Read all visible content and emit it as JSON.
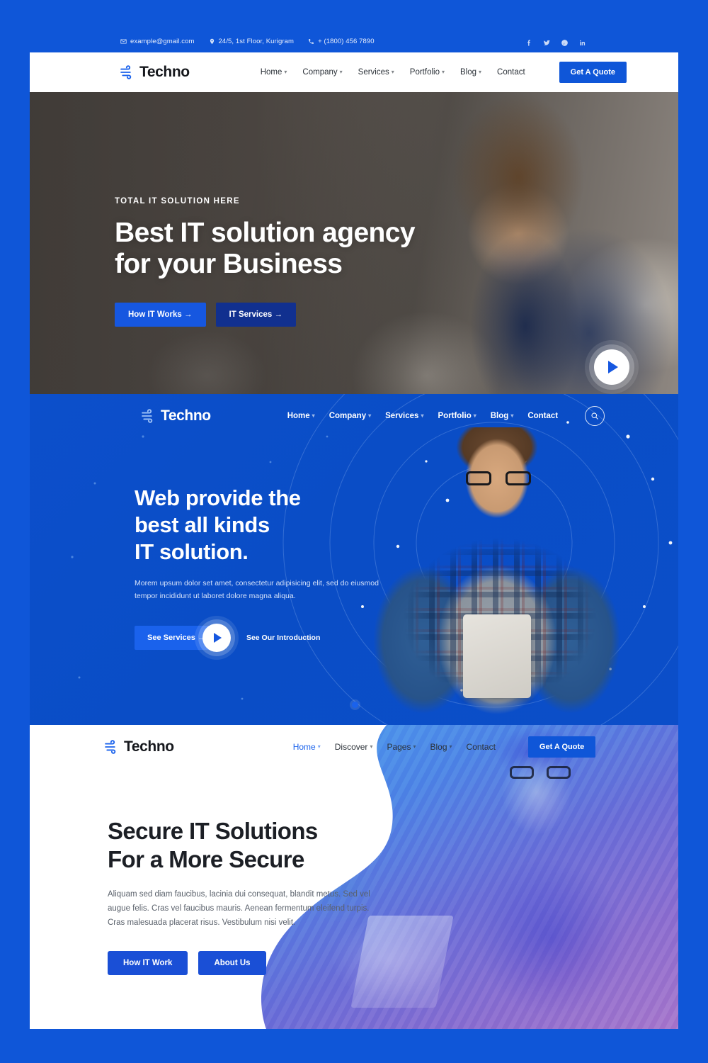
{
  "brand": {
    "name": "Techno",
    "logo_icon": "wind-swoosh-icon",
    "accent": "#0f56d8",
    "dark_accent": "#11308f"
  },
  "panel1": {
    "topbar": {
      "email": "example@gmail.com",
      "email_icon": "envelope-icon",
      "address": "24/5, 1st Floor, Kurigram",
      "address_icon": "map-pin-icon",
      "phone": "+ (1800) 456 7890",
      "phone_icon": "phone-icon",
      "social": [
        {
          "name": "facebook-icon",
          "label": "f"
        },
        {
          "name": "twitter-icon",
          "label": "t"
        },
        {
          "name": "pinterest-icon",
          "label": "p"
        },
        {
          "name": "linkedin-icon",
          "label": "in"
        }
      ]
    },
    "nav": [
      {
        "label": "Home",
        "caret": true
      },
      {
        "label": "Company",
        "caret": true
      },
      {
        "label": "Services",
        "caret": true
      },
      {
        "label": "Portfolio",
        "caret": true
      },
      {
        "label": "Blog",
        "caret": true
      },
      {
        "label": "Contact",
        "caret": false
      }
    ],
    "cta": "Get A Quote",
    "hero": {
      "eyebrow": "TOTAL IT SOLUTION HERE",
      "title_line1": "Best IT solution agency",
      "title_line2": "for your Business",
      "btn_primary": "How IT Works  →",
      "btn_secondary": "IT Services  →",
      "play_icon": "play-button-icon"
    }
  },
  "panel2": {
    "nav": [
      {
        "label": "Home",
        "caret": true
      },
      {
        "label": "Company",
        "caret": true
      },
      {
        "label": "Services",
        "caret": true
      },
      {
        "label": "Portfolio",
        "caret": true
      },
      {
        "label": "Blog",
        "caret": true
      },
      {
        "label": "Contact",
        "caret": false
      }
    ],
    "search_icon": "search-icon",
    "hero": {
      "title_line1": "Web provide the",
      "title_line2": "best all kinds",
      "title_line3": "IT solution.",
      "subtitle": "Morem upsum dolor set amet, consectetur adipisicing elit, sed do eiusmod tempor incididunt ut laboret dolore magna aliqua.",
      "btn_primary": "See Services  →",
      "play_icon": "play-button-icon",
      "intro_label": "See Our Introduction"
    },
    "slider_dot": "active-slide-dot"
  },
  "panel3": {
    "nav": [
      {
        "label": "Home",
        "caret": true,
        "active": true
      },
      {
        "label": "Discover",
        "caret": true,
        "active": false
      },
      {
        "label": "Pages",
        "caret": true,
        "active": false
      },
      {
        "label": "Blog",
        "caret": true,
        "active": false
      },
      {
        "label": "Contact",
        "caret": false,
        "active": false
      }
    ],
    "cta": "Get A Quote",
    "hero": {
      "title_line1": "Secure IT Solutions",
      "title_line2": "For a More Secure",
      "subtitle": "Aliquam sed diam faucibus, lacinia dui consequat, blandit metus. Sed vel augue felis. Cras vel faucibus mauris. Aenean fermentum eleifend turpis. Cras malesuada placerat risus. Vestibulum nisi velit.",
      "btn_primary": "How IT Work",
      "btn_secondary": "About Us"
    }
  }
}
